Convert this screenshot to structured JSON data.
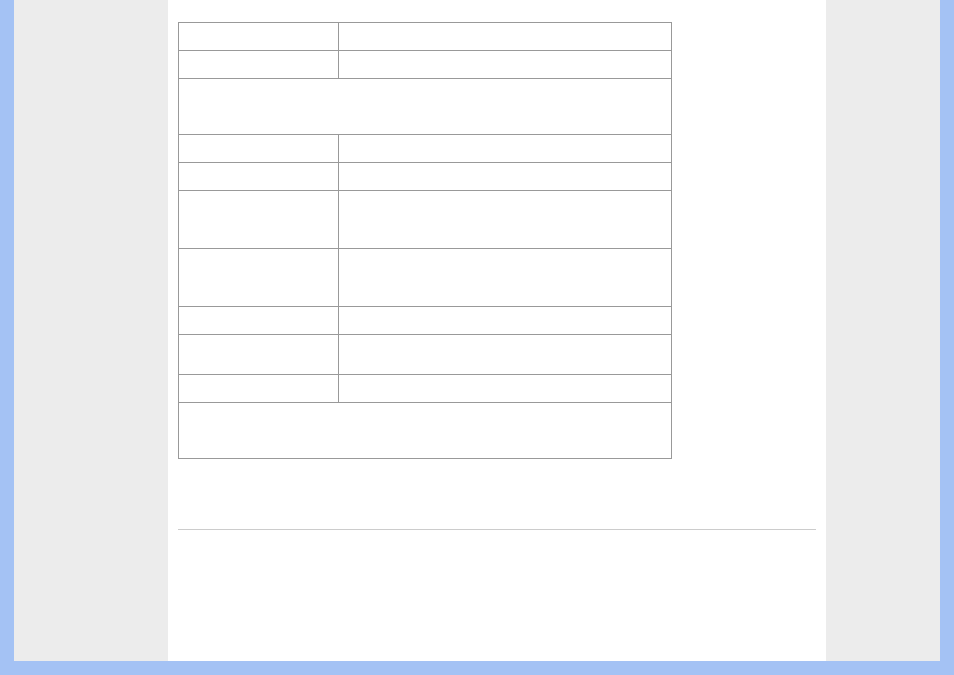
{
  "table": {
    "rows": [
      {
        "span": false,
        "label": "",
        "value": ""
      },
      {
        "span": false,
        "label": "",
        "value": ""
      },
      {
        "span": true,
        "text": ""
      },
      {
        "span": false,
        "label": "",
        "value": ""
      },
      {
        "span": false,
        "label": "",
        "value": ""
      },
      {
        "span": false,
        "label": "",
        "value": ""
      },
      {
        "span": false,
        "label": "",
        "value": ""
      },
      {
        "span": false,
        "label": "",
        "value": ""
      },
      {
        "span": false,
        "label": "",
        "value": ""
      },
      {
        "span": false,
        "label": "",
        "value": ""
      },
      {
        "span": true,
        "text": ""
      }
    ]
  },
  "footer": {
    "link_text": " "
  }
}
